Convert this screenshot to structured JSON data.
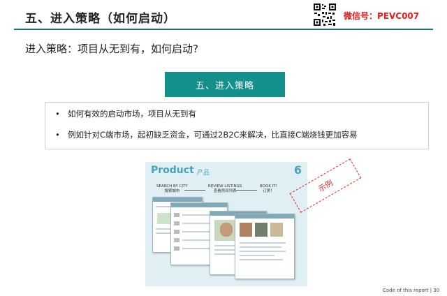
{
  "header": {
    "title": "五、进入策略（如何启动）",
    "wechat": "微信号：PEVC007"
  },
  "subtitle": "进入策略：项目从无到有，如何启动?",
  "banner": "五、进入策略",
  "bullets": [
    "如何有效的启动市场，项目从无到有",
    "例如针对C端市场，起初缺乏资金，可通过2B2C来解决，比直接C端烧钱更加容易"
  ],
  "product_image": {
    "title": "Product",
    "title_cn": "产品",
    "number": "6",
    "steps": [
      {
        "en": "SEARCH BY CITY",
        "cn": "搜索城市"
      },
      {
        "en": "REVIEW LISTINGS",
        "cn": "查看房间列表"
      },
      {
        "en": "BOOK IT!",
        "cn": "订房！"
      }
    ]
  },
  "stamp": "示例",
  "footer": "Code of this report  | 30",
  "colors": {
    "accent_teal": "#138f8c",
    "rule_blue": "#1d6f86",
    "wechat_red": "#e02020",
    "stamp_red": "#d92a2a"
  }
}
